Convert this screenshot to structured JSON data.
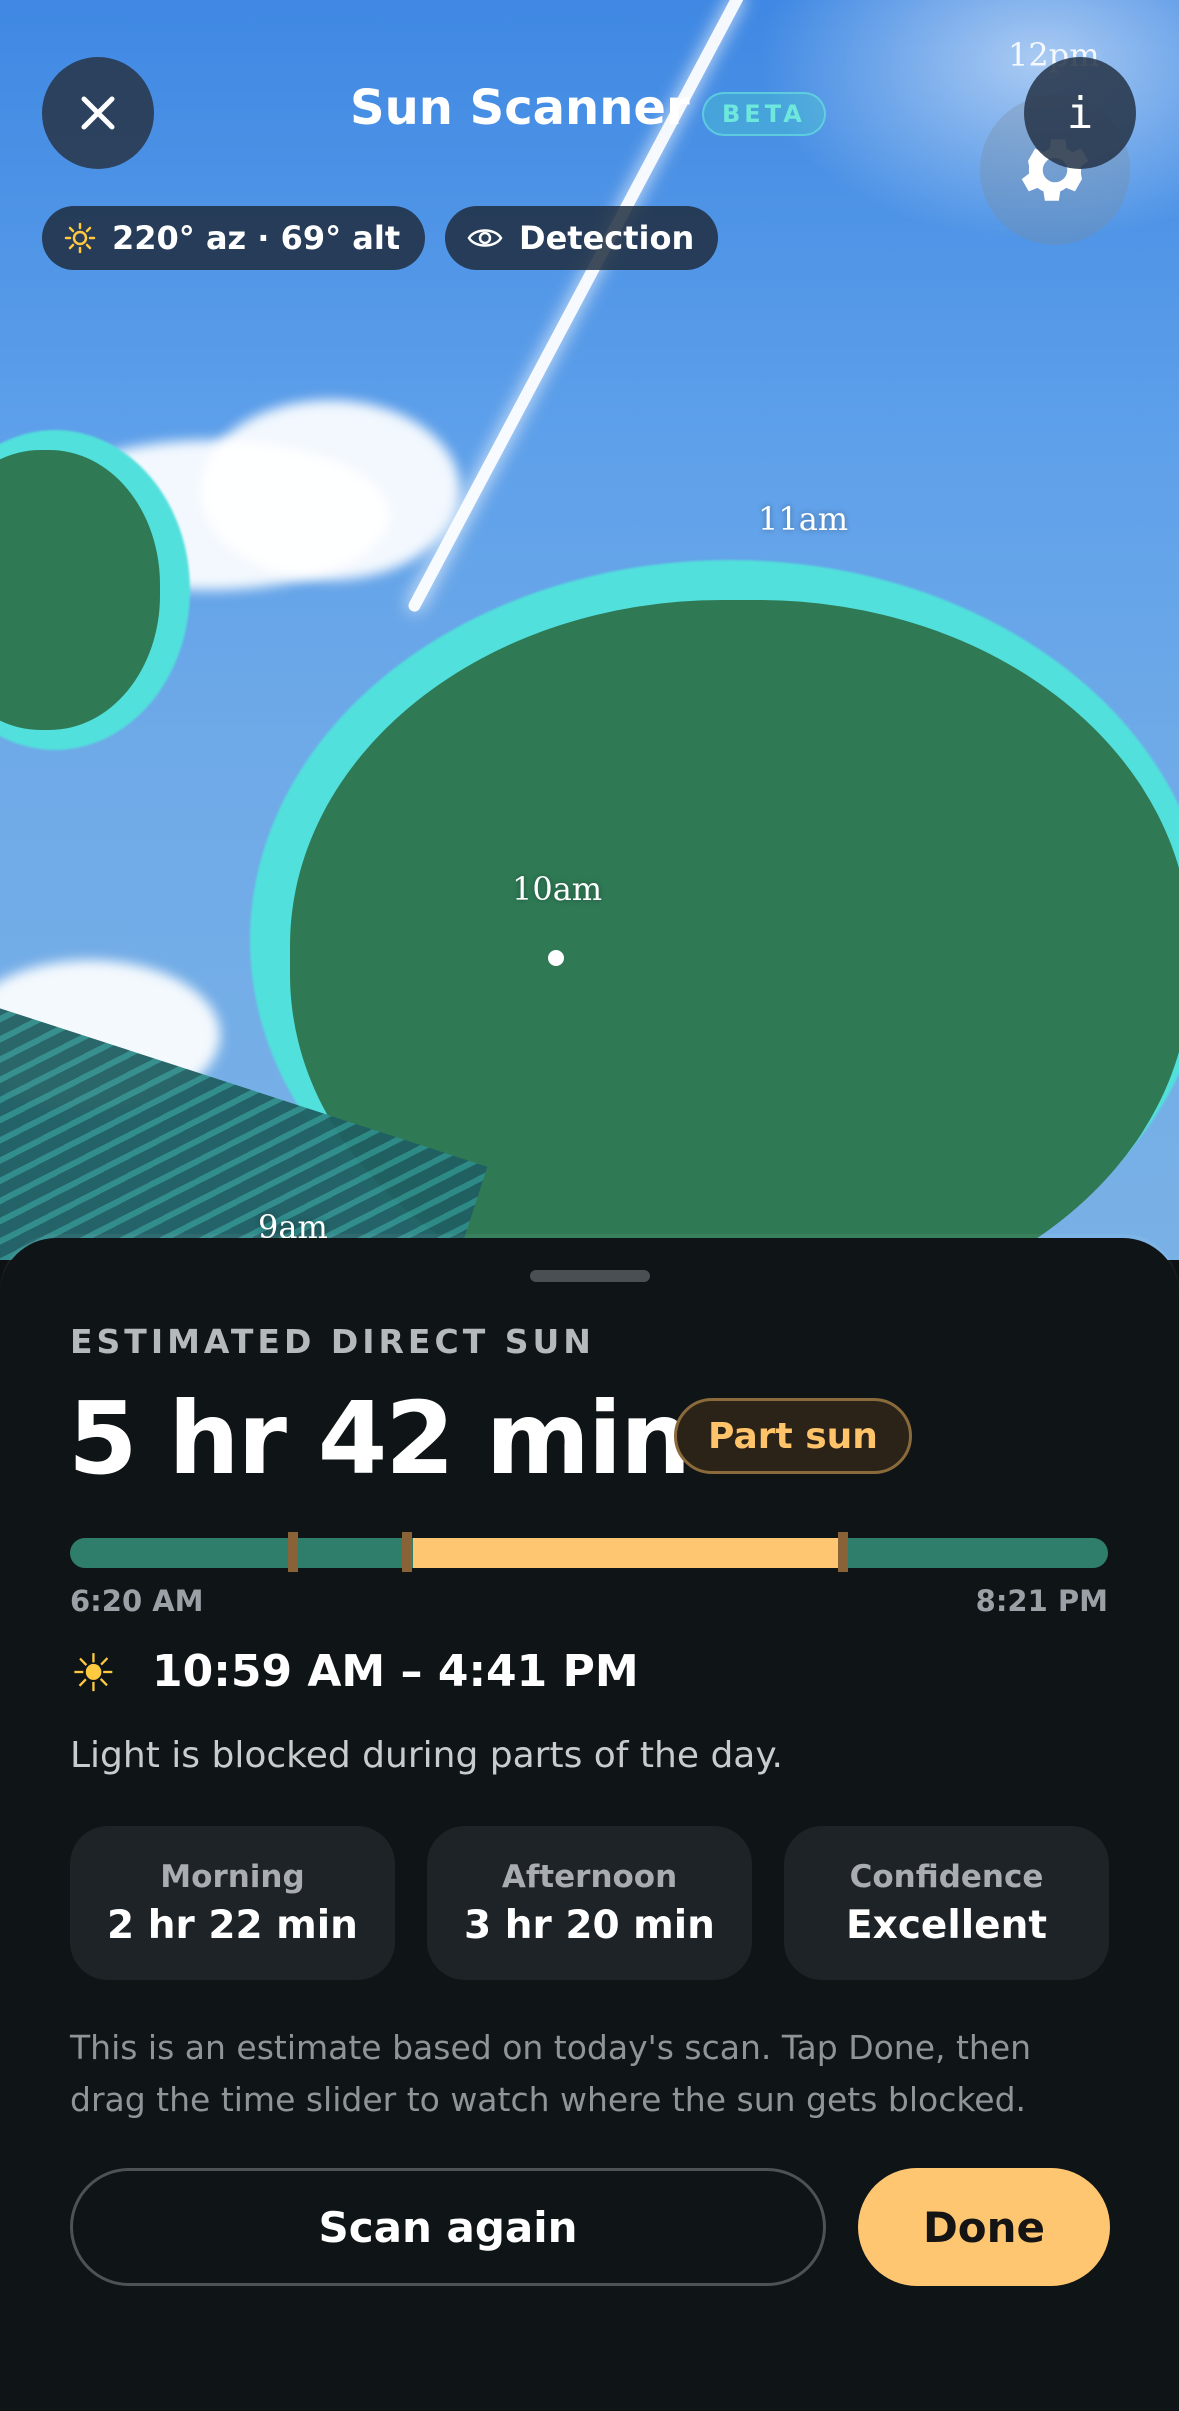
{
  "header": {
    "title": "Sun Scanner",
    "beta_label": "BETA",
    "sun_position": "220° az · 69° alt",
    "detection_label": "Detection",
    "info_label": "i"
  },
  "camera": {
    "hour_labels": [
      "12pm",
      "11am",
      "10am",
      "9am"
    ]
  },
  "sheet": {
    "eyebrow": "ESTIMATED DIRECT SUN",
    "duration": "5 hr 42 min",
    "badge": "Part sun",
    "timeline": {
      "start_label": "6:20 AM",
      "end_label": "8:21 PM",
      "sun_fraction_start": 0.33,
      "sun_fraction_end": 0.75
    },
    "sun_window": "10:59 AM – 4:41 PM",
    "note": "Light is blocked during parts of the day.",
    "stats": [
      {
        "label": "Morning",
        "value": "2 hr 22 min"
      },
      {
        "label": "Afternoon",
        "value": "3 hr 20 min"
      },
      {
        "label": "Confidence",
        "value": "Excellent"
      }
    ],
    "footnote": "This is an estimate based on today's scan. Tap Done, then drag the time slider to watch where the sun gets blocked.",
    "scan_again_label": "Scan again",
    "done_label": "Done"
  },
  "colors": {
    "accent": "#ffc672",
    "sun_bar": "#ffc672",
    "shade_bar": "#2f7e6c",
    "badge_text": "#ffc46a",
    "beta_text": "#6ee8dc"
  }
}
